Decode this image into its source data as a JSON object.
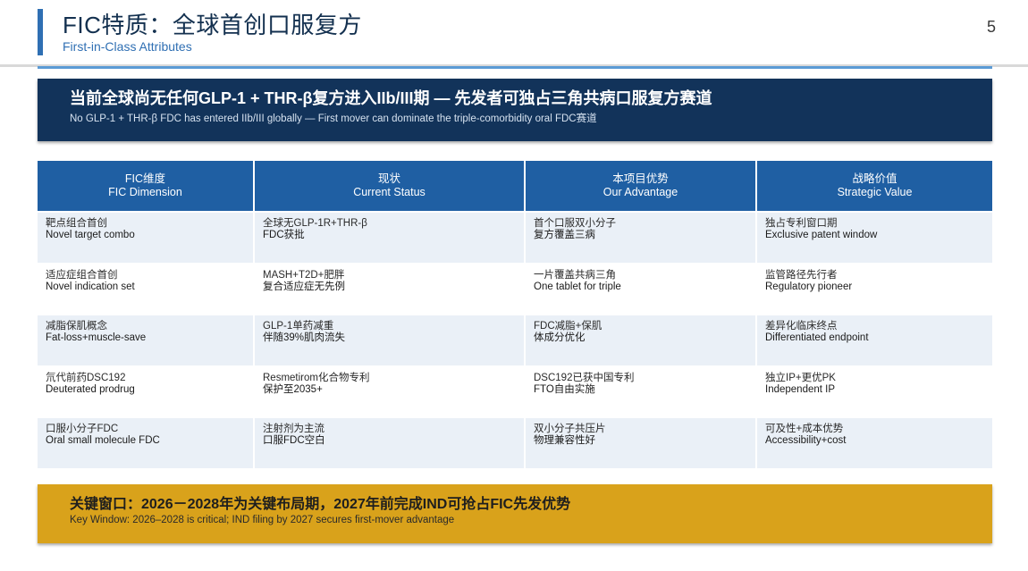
{
  "header": {
    "title": "FIC特质：全球首创口服复方",
    "subtitle": "First-in-Class Attributes",
    "page_number": "5"
  },
  "banner": {
    "text_cn": "当前全球尚无任何GLP-1 + THR-β复方进入IIb/III期 — 先发者可独占三角共病口服复方赛道",
    "text_en": "No GLP-1 + THR-β FDC has entered IIb/III globally — First mover can dominate the triple-comorbidity oral FDC赛道"
  },
  "table": {
    "headers": [
      {
        "cn": "FIC维度",
        "en": "FIC Dimension"
      },
      {
        "cn": "现状",
        "en": "Current Status"
      },
      {
        "cn": "本项目优势",
        "en": "Our Advantage"
      },
      {
        "cn": "战略价值",
        "en": "Strategic Value"
      }
    ],
    "rows": [
      [
        {
          "cn": "靶点组合首创",
          "en": "Novel target combo"
        },
        {
          "cn": "全球无GLP-1R+THR-β",
          "en": "FDC获批"
        },
        {
          "cn": "首个口服双小分子",
          "en": "复方覆盖三病"
        },
        {
          "cn": "独占专利窗口期",
          "en": "Exclusive patent window"
        }
      ],
      [
        {
          "cn": "适应症组合首创",
          "en": "Novel indication set"
        },
        {
          "cn": "MASH+T2D+肥胖",
          "en": "复合适应症无先例"
        },
        {
          "cn": "一片覆盖共病三角",
          "en": "One tablet for triple"
        },
        {
          "cn": "监管路径先行者",
          "en": "Regulatory pioneer"
        }
      ],
      [
        {
          "cn": "减脂保肌概念",
          "en": "Fat-loss+muscle-save"
        },
        {
          "cn": "GLP-1单药减重",
          "en": "伴随39%肌肉流失"
        },
        {
          "cn": "FDC减脂+保肌",
          "en": "体成分优化"
        },
        {
          "cn": "差异化临床终点",
          "en": "Differentiated endpoint"
        }
      ],
      [
        {
          "cn": "氘代前药DSC192",
          "en": "Deuterated prodrug"
        },
        {
          "cn": "Resmetirom化合物专利",
          "en": "保护至2035+"
        },
        {
          "cn": "DSC192已获中国专利",
          "en": "FTO自由实施"
        },
        {
          "cn": "独立IP+更优PK",
          "en": "Independent IP"
        }
      ],
      [
        {
          "cn": "口服小分子FDC",
          "en": "Oral small molecule FDC"
        },
        {
          "cn": "注射剂为主流",
          "en": "口服FDC空白"
        },
        {
          "cn": "双小分子共压片",
          "en": "物理兼容性好"
        },
        {
          "cn": "可及性+成本优势",
          "en": "Accessibility+cost"
        }
      ]
    ]
  },
  "callout": {
    "text_cn": "关键窗口：2026－2028年为关键布局期，2027年前完成IND可抢占FIC先发优势",
    "text_en": "Key Window: 2026–2028 is critical; IND filing by 2027 secures first-mover advantage"
  },
  "colors": {
    "navy": "#12335a",
    "header_blue": "#1f5fa3",
    "accent_blue": "#2f6fb3",
    "row_tint": "#eaf0f7",
    "gold": "#d9a21b"
  }
}
